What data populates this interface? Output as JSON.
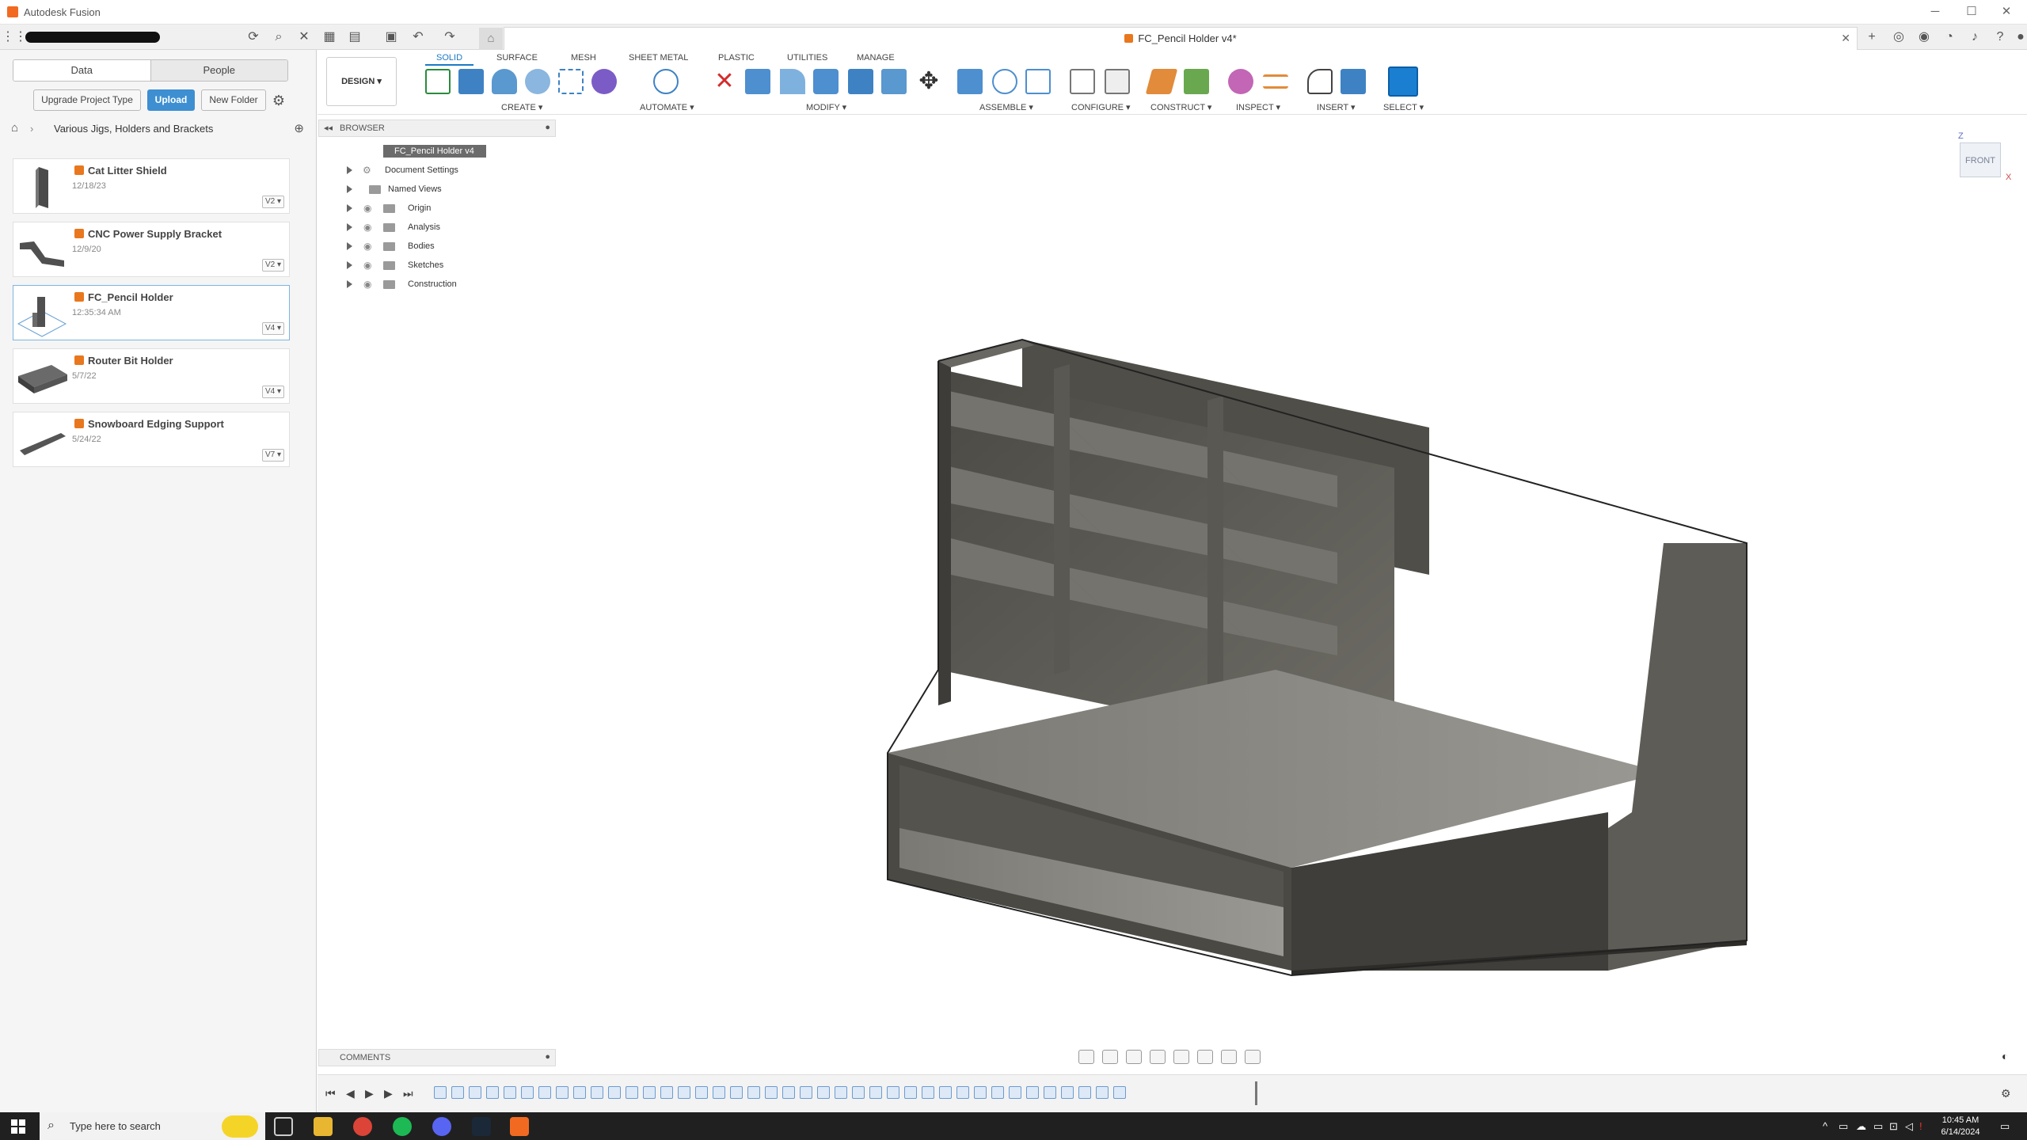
{
  "window": {
    "title": "Autodesk Fusion",
    "minimize": "─",
    "maximize": "☐",
    "close": "✕"
  },
  "appbar": {
    "document_tab": "FC_Pencil Holder v4*",
    "tab_close": "✕"
  },
  "data_panel": {
    "tabs": [
      "Data",
      "People"
    ],
    "buttons": {
      "upgrade": "Upgrade Project Type",
      "upload": "Upload",
      "new_folder": "New Folder"
    },
    "breadcrumb": "Various Jigs, Holders and Brackets",
    "items": [
      {
        "name": "Cat Litter Shield",
        "date": "12/18/23",
        "version": "V2 ▾"
      },
      {
        "name": "CNC Power Supply Bracket",
        "date": "12/9/20",
        "version": "V2 ▾"
      },
      {
        "name": "FC_Pencil Holder",
        "date": "12:35:34 AM",
        "version": "V4 ▾"
      },
      {
        "name": "Router Bit Holder",
        "date": "5/7/22",
        "version": "V4 ▾"
      },
      {
        "name": "Snowboard Edging Support",
        "date": "5/24/22",
        "version": "V7 ▾"
      }
    ]
  },
  "toolbar": {
    "design_button": "DESIGN ▾",
    "tabs": [
      "SOLID",
      "SURFACE",
      "MESH",
      "SHEET METAL",
      "PLASTIC",
      "UTILITIES",
      "MANAGE"
    ],
    "groups": [
      "CREATE ▾",
      "AUTOMATE ▾",
      "MODIFY ▾",
      "ASSEMBLE ▾",
      "CONFIGURE ▾",
      "CONSTRUCT ▾",
      "INSPECT ▾",
      "INSERT ▾",
      "SELECT ▾"
    ]
  },
  "browser": {
    "title": "BROWSER",
    "root": "FC_Pencil Holder v4",
    "nodes": [
      "Document Settings",
      "Named Views",
      "Origin",
      "Analysis",
      "Bodies",
      "Sketches",
      "Construction"
    ]
  },
  "viewcube": {
    "face": "FRONT",
    "z": "Z",
    "x": "X"
  },
  "comments": {
    "title": "COMMENTS"
  },
  "taskbar": {
    "search_placeholder": "Type here to search",
    "time": "10:45 AM",
    "date": "6/14/2024"
  },
  "colors": {
    "accent": "#1b79c7",
    "upload": "#3d8fd1",
    "fusion_orange": "#e8771e",
    "model_body": "#5e5c56",
    "taskbar": "#202020"
  }
}
